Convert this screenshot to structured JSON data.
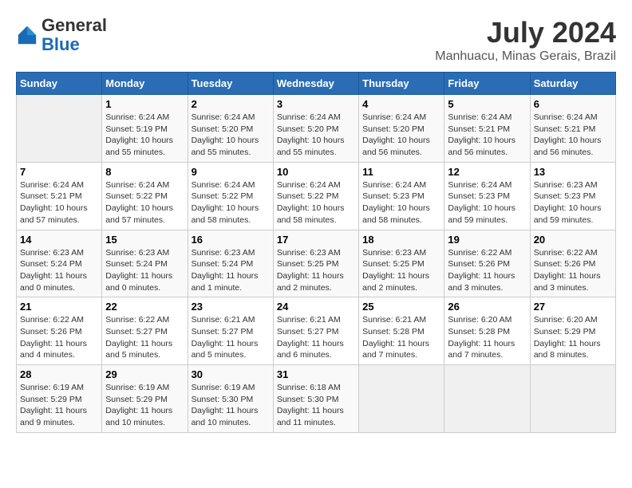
{
  "header": {
    "logo_general": "General",
    "logo_blue": "Blue",
    "month": "July 2024",
    "location": "Manhuacu, Minas Gerais, Brazil"
  },
  "days_of_week": [
    "Sunday",
    "Monday",
    "Tuesday",
    "Wednesday",
    "Thursday",
    "Friday",
    "Saturday"
  ],
  "weeks": [
    [
      {
        "day": "",
        "info": ""
      },
      {
        "day": "1",
        "info": "Sunrise: 6:24 AM\nSunset: 5:19 PM\nDaylight: 10 hours\nand 55 minutes."
      },
      {
        "day": "2",
        "info": "Sunrise: 6:24 AM\nSunset: 5:20 PM\nDaylight: 10 hours\nand 55 minutes."
      },
      {
        "day": "3",
        "info": "Sunrise: 6:24 AM\nSunset: 5:20 PM\nDaylight: 10 hours\nand 55 minutes."
      },
      {
        "day": "4",
        "info": "Sunrise: 6:24 AM\nSunset: 5:20 PM\nDaylight: 10 hours\nand 56 minutes."
      },
      {
        "day": "5",
        "info": "Sunrise: 6:24 AM\nSunset: 5:21 PM\nDaylight: 10 hours\nand 56 minutes."
      },
      {
        "day": "6",
        "info": "Sunrise: 6:24 AM\nSunset: 5:21 PM\nDaylight: 10 hours\nand 56 minutes."
      }
    ],
    [
      {
        "day": "7",
        "info": "Sunrise: 6:24 AM\nSunset: 5:21 PM\nDaylight: 10 hours\nand 57 minutes."
      },
      {
        "day": "8",
        "info": "Sunrise: 6:24 AM\nSunset: 5:22 PM\nDaylight: 10 hours\nand 57 minutes."
      },
      {
        "day": "9",
        "info": "Sunrise: 6:24 AM\nSunset: 5:22 PM\nDaylight: 10 hours\nand 58 minutes."
      },
      {
        "day": "10",
        "info": "Sunrise: 6:24 AM\nSunset: 5:22 PM\nDaylight: 10 hours\nand 58 minutes."
      },
      {
        "day": "11",
        "info": "Sunrise: 6:24 AM\nSunset: 5:23 PM\nDaylight: 10 hours\nand 58 minutes."
      },
      {
        "day": "12",
        "info": "Sunrise: 6:24 AM\nSunset: 5:23 PM\nDaylight: 10 hours\nand 59 minutes."
      },
      {
        "day": "13",
        "info": "Sunrise: 6:23 AM\nSunset: 5:23 PM\nDaylight: 10 hours\nand 59 minutes."
      }
    ],
    [
      {
        "day": "14",
        "info": "Sunrise: 6:23 AM\nSunset: 5:24 PM\nDaylight: 11 hours\nand 0 minutes."
      },
      {
        "day": "15",
        "info": "Sunrise: 6:23 AM\nSunset: 5:24 PM\nDaylight: 11 hours\nand 0 minutes."
      },
      {
        "day": "16",
        "info": "Sunrise: 6:23 AM\nSunset: 5:24 PM\nDaylight: 11 hours\nand 1 minute."
      },
      {
        "day": "17",
        "info": "Sunrise: 6:23 AM\nSunset: 5:25 PM\nDaylight: 11 hours\nand 2 minutes."
      },
      {
        "day": "18",
        "info": "Sunrise: 6:23 AM\nSunset: 5:25 PM\nDaylight: 11 hours\nand 2 minutes."
      },
      {
        "day": "19",
        "info": "Sunrise: 6:22 AM\nSunset: 5:26 PM\nDaylight: 11 hours\nand 3 minutes."
      },
      {
        "day": "20",
        "info": "Sunrise: 6:22 AM\nSunset: 5:26 PM\nDaylight: 11 hours\nand 3 minutes."
      }
    ],
    [
      {
        "day": "21",
        "info": "Sunrise: 6:22 AM\nSunset: 5:26 PM\nDaylight: 11 hours\nand 4 minutes."
      },
      {
        "day": "22",
        "info": "Sunrise: 6:22 AM\nSunset: 5:27 PM\nDaylight: 11 hours\nand 5 minutes."
      },
      {
        "day": "23",
        "info": "Sunrise: 6:21 AM\nSunset: 5:27 PM\nDaylight: 11 hours\nand 5 minutes."
      },
      {
        "day": "24",
        "info": "Sunrise: 6:21 AM\nSunset: 5:27 PM\nDaylight: 11 hours\nand 6 minutes."
      },
      {
        "day": "25",
        "info": "Sunrise: 6:21 AM\nSunset: 5:28 PM\nDaylight: 11 hours\nand 7 minutes."
      },
      {
        "day": "26",
        "info": "Sunrise: 6:20 AM\nSunset: 5:28 PM\nDaylight: 11 hours\nand 7 minutes."
      },
      {
        "day": "27",
        "info": "Sunrise: 6:20 AM\nSunset: 5:29 PM\nDaylight: 11 hours\nand 8 minutes."
      }
    ],
    [
      {
        "day": "28",
        "info": "Sunrise: 6:19 AM\nSunset: 5:29 PM\nDaylight: 11 hours\nand 9 minutes."
      },
      {
        "day": "29",
        "info": "Sunrise: 6:19 AM\nSunset: 5:29 PM\nDaylight: 11 hours\nand 10 minutes."
      },
      {
        "day": "30",
        "info": "Sunrise: 6:19 AM\nSunset: 5:30 PM\nDaylight: 11 hours\nand 10 minutes."
      },
      {
        "day": "31",
        "info": "Sunrise: 6:18 AM\nSunset: 5:30 PM\nDaylight: 11 hours\nand 11 minutes."
      },
      {
        "day": "",
        "info": ""
      },
      {
        "day": "",
        "info": ""
      },
      {
        "day": "",
        "info": ""
      }
    ]
  ]
}
